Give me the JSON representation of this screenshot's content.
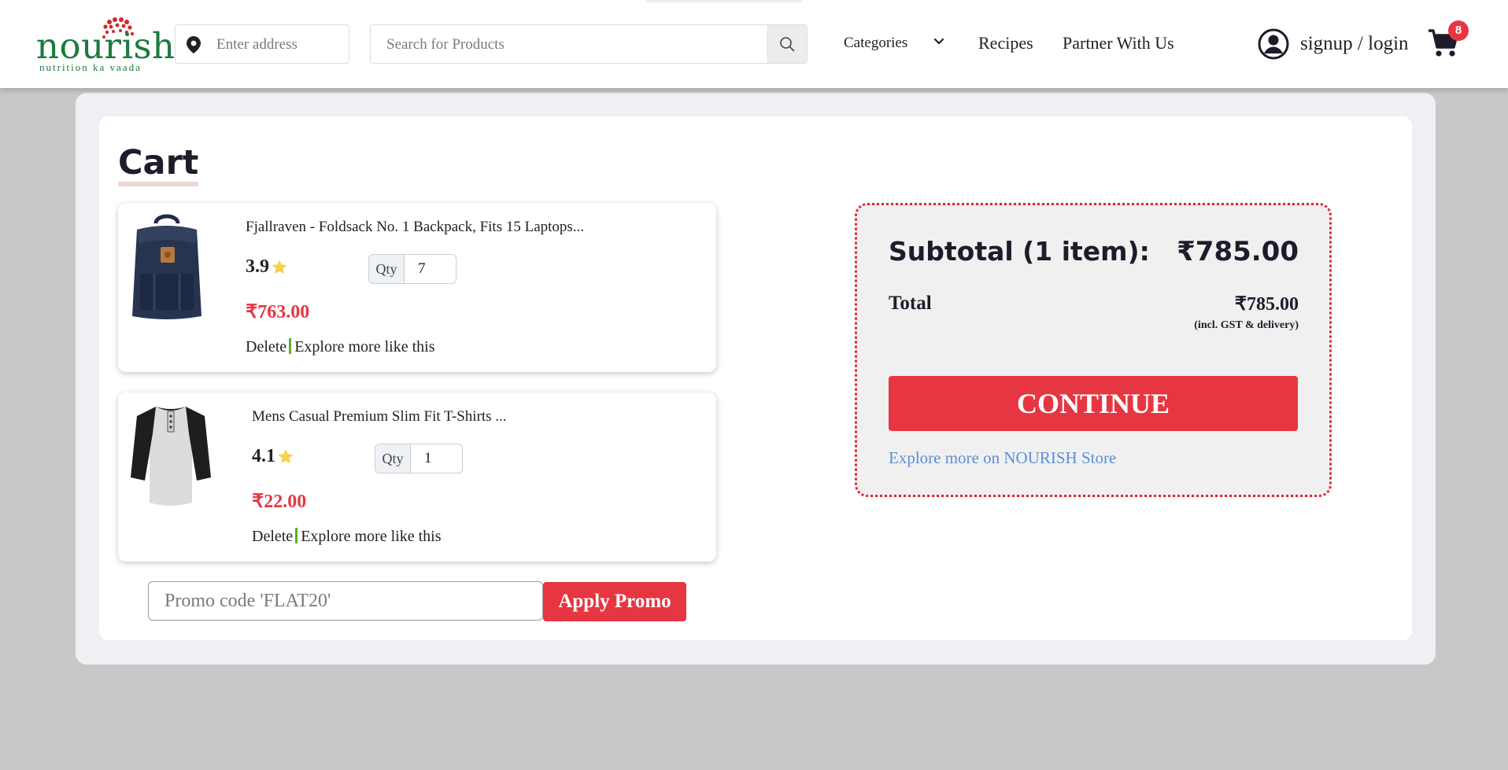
{
  "header": {
    "logo_text": "nourish",
    "logo_tagline": "nutrition ka vaada",
    "address_placeholder": "Enter address",
    "search_placeholder": "Search for Products",
    "nav": {
      "categories": "Categories",
      "recipes": "Recipes",
      "partner": "Partner With Us"
    },
    "login": "signup / login",
    "cart_count": "8"
  },
  "cart": {
    "title": "Cart",
    "items": [
      {
        "name": "Fjallraven - Foldsack No. 1 Backpack, Fits 15 Laptops...",
        "rating": "3.9",
        "qty_label": "Qty",
        "qty": "7",
        "price": "₹763.00",
        "delete_label": "Delete",
        "explore_label": "Explore more like this"
      },
      {
        "name": "Mens Casual Premium Slim Fit T-Shirts ...",
        "rating": "4.1",
        "qty_label": "Qty",
        "qty": "1",
        "price": "₹22.00",
        "delete_label": "Delete",
        "explore_label": "Explore more like this"
      }
    ],
    "promo_placeholder": "Promo code 'FLAT20'",
    "promo_button": "Apply Promo"
  },
  "summary": {
    "subtotal_label": "Subtotal (1 item):",
    "subtotal_value": "₹785.00",
    "total_label": "Total",
    "total_value": "₹785.00",
    "total_note": "(incl. GST & delivery)",
    "continue_label": "CONTINUE",
    "explore_store": "Explore more on NOURISH Store"
  },
  "colors": {
    "brand_green": "#1c7a3d",
    "accent_red": "#e63642",
    "link_blue": "#5b8fd6",
    "star_yellow": "#f7d24a"
  }
}
